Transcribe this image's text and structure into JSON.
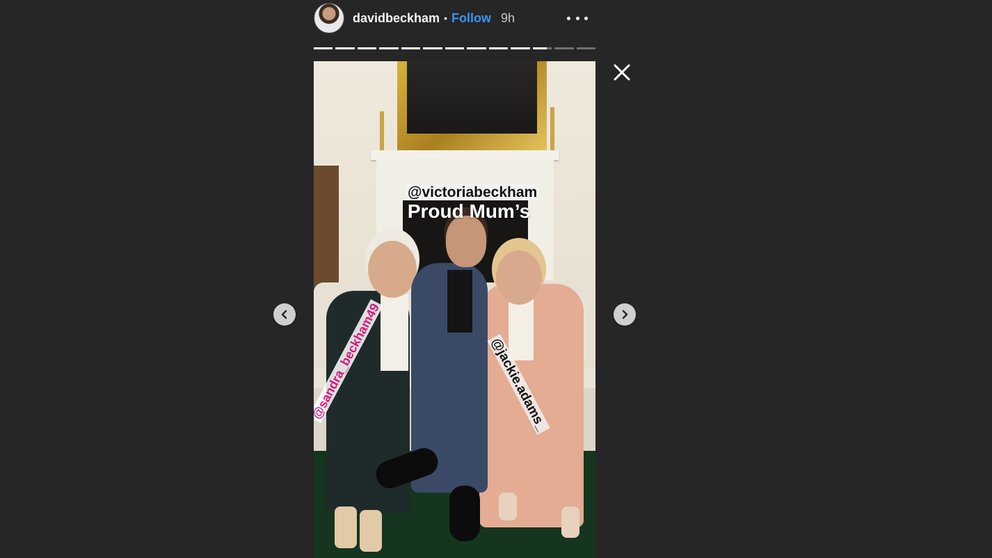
{
  "header": {
    "username": "davidbeckham",
    "separator": "•",
    "follow_label": "Follow",
    "time": "9h",
    "avatar_icon": "avatar",
    "more_icon": "more-options-icon"
  },
  "progress": {
    "segments_total": 13,
    "segments_completed": 10,
    "current_segment_fill": 0.75
  },
  "story": {
    "mention_top": "@victoriabeckham",
    "caption": "Proud Mum’s",
    "mention_left": "@sandra_beckham49",
    "mention_right": "@jackie.adams_"
  },
  "controls": {
    "close_icon": "close-icon",
    "prev_icon": "chevron-left-icon",
    "next_icon": "chevron-right-icon"
  },
  "colors": {
    "background": "#262626",
    "follow": "#3897f0",
    "mention_left": "#d9177f"
  }
}
